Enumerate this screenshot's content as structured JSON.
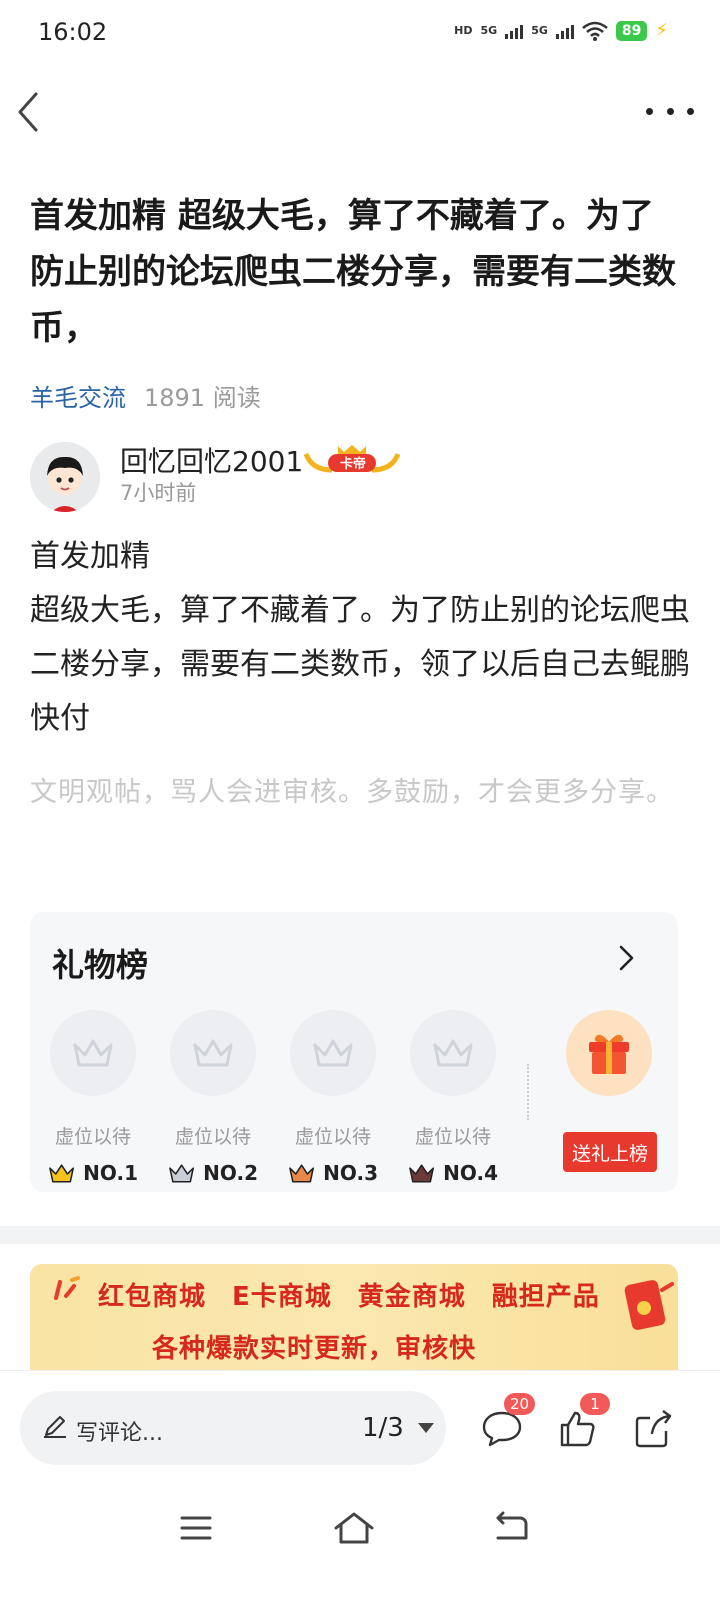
{
  "status_bar": {
    "time": "16:02",
    "hd_label": "HD",
    "net1": "5G",
    "net2": "5G",
    "battery": "89"
  },
  "post": {
    "title": "首发加精 超级大毛，算了不藏着了。为了防止别的论坛爬虫二楼分享，需要有二类数币，",
    "forum": "羊毛交流",
    "reads": "1891 阅读",
    "author": "回忆回忆2001",
    "badge": "卡帝",
    "time_ago": "7小时前",
    "content_line1": "首发加精",
    "content_line2": "超级大毛，算了不藏着了。为了防止别的论坛爬虫二楼分享，需要有二类数币，领了以后自己去鲲鹏快付",
    "notice": "文明观帖，骂人会进审核。多鼓励，才会更多分享。"
  },
  "gift_board": {
    "title": "礼物榜",
    "slots": [
      {
        "placeholder": "虚位以待",
        "rank": "NO.1",
        "crown_color": "#f5c21b"
      },
      {
        "placeholder": "虚位以待",
        "rank": "NO.2",
        "crown_color": "#c9ced6"
      },
      {
        "placeholder": "虚位以待",
        "rank": "NO.3",
        "crown_color": "#e8894a"
      },
      {
        "placeholder": "虚位以待",
        "rank": "NO.4",
        "crown_color": "#6b3b3b"
      }
    ],
    "send_label": "送礼上榜"
  },
  "banner": {
    "items": [
      "红包商城",
      "E卡商城",
      "黄金商城",
      "融担产品"
    ],
    "subtitle": "各种爆款实时更新，审核快"
  },
  "bottom_bar": {
    "comment_placeholder": "写评论...",
    "page_indicator": "1/3",
    "comment_count": "20",
    "like_count": "1"
  },
  "colors": {
    "accent_blue": "#2a63a7",
    "badge_red": "#f25a5a",
    "send_red": "#e8392e"
  }
}
